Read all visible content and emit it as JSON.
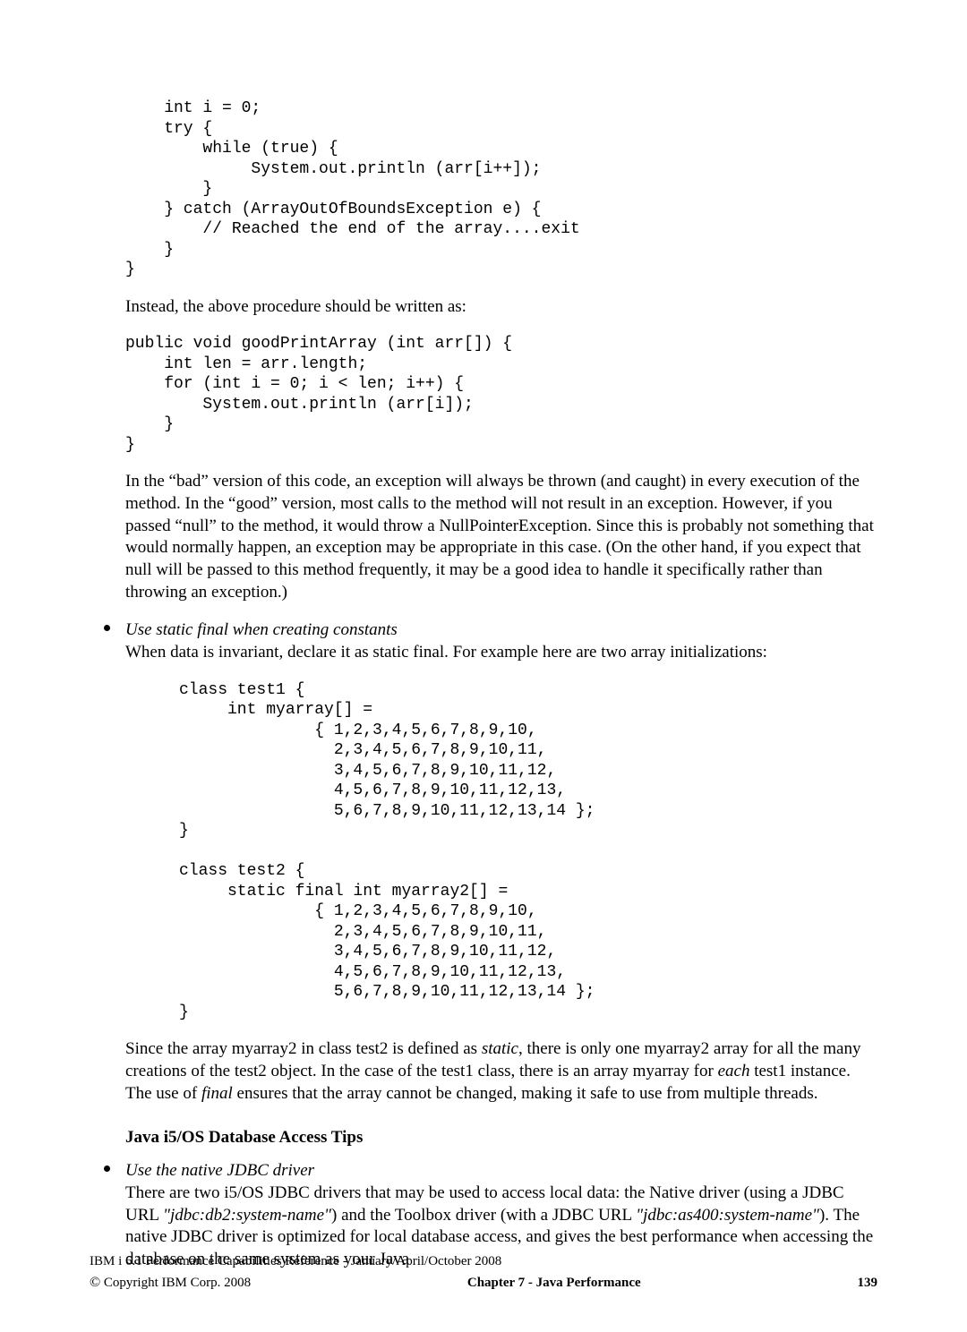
{
  "code_block_1": "    int i = 0;\n    try {\n        while (true) {\n             System.out.println (arr[i++]);\n        }\n    } catch (ArrayOutOfBoundsException e) {\n        // Reached the end of the array....exit\n    }\n}",
  "para_instead": "Instead, the above procedure should be written as:",
  "code_block_2": "public void goodPrintArray (int arr[]) {\n    int len = arr.length;\n    for (int i = 0; i < len; i++) {\n        System.out.println (arr[i]);\n    }\n}",
  "para_bad_good": "In the “bad” version of this code, an exception will always be thrown (and caught) in every execution of the method.  In the “good” version, most calls to the method will not result in an exception. However, if you passed “null” to the method, it would throw a NullPointerException.  Since this is probably not something that would normally happen, an exception  may be appropriate in this case. (On the other hand, if you expect that null will be passed to this method frequently, it may be a good idea to handle it specifically rather than throwing an exception.)",
  "bullet1_title": "Use static final when creating constants",
  "bullet1_text": "When data is invariant, declare it as static final. For example here are two array initializations:",
  "code_block_3": "class test1 {\n     int myarray[] =\n              { 1,2,3,4,5,6,7,8,9,10,\n                2,3,4,5,6,7,8,9,10,11,\n                3,4,5,6,7,8,9,10,11,12,\n                4,5,6,7,8,9,10,11,12,13,\n                5,6,7,8,9,10,11,12,13,14 };\n}\n\nclass test2 {\n     static final int myarray2[] =\n              { 1,2,3,4,5,6,7,8,9,10,\n                2,3,4,5,6,7,8,9,10,11,\n                3,4,5,6,7,8,9,10,11,12,\n                4,5,6,7,8,9,10,11,12,13,\n                5,6,7,8,9,10,11,12,13,14 };\n}",
  "para_since_pre": "Since the array myarray2 in class test2 is defined as ",
  "word_static": "static",
  "para_since_mid": ", there is only one myarray2 array for all the many creations of the test2 object. In the case of the test1 class, there is an array myarray for ",
  "word_each": "each",
  "para_since_mid2": " test1 instance.  The use of ",
  "word_final": "final",
  "para_since_post": " ensures that the array cannot be changed, making it safe to use from multiple threads.",
  "section_heading": "Java i5/OS Database Access Tips",
  "bullet2_title": "Use the native JDBC driver",
  "bullet2_text_pre": "There are two i5/OS JDBC drivers that may be used to access local data:  the Native driver (using a JDBC URL ",
  "url1": "\"jdbc:db2:system-name\"",
  "bullet2_text_mid": ") and the Toolbox driver (with a JDBC URL ",
  "url2": "\"jdbc:as400:system-name\"",
  "bullet2_text_post": ").  The native JDBC driver is optimized for local database access, and gives the best performance when accessing the database on the same system as your Java",
  "footer_line1": "IBM i 6.1 Performance Capabilities Reference - January/April/October 2008",
  "footer_copyright": " Copyright IBM Corp. 2008",
  "footer_chapter": "Chapter 7 - Java Performance",
  "footer_page": "139"
}
